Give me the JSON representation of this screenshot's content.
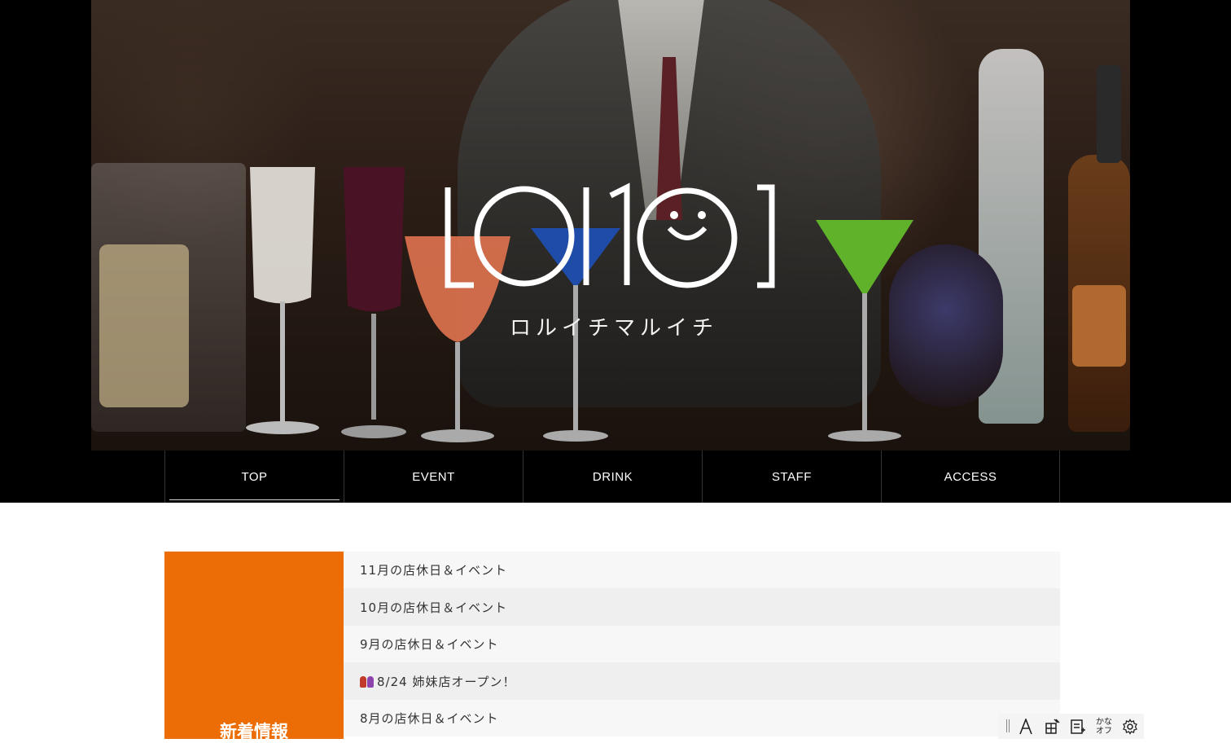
{
  "hero": {
    "logo_text": "LOI101",
    "logo_subtitle": "ロルイチマルイチ"
  },
  "nav": {
    "items": [
      {
        "label": "TOP"
      },
      {
        "label": "EVENT"
      },
      {
        "label": "DRINK"
      },
      {
        "label": "STAFF"
      },
      {
        "label": "ACCESS"
      }
    ]
  },
  "news": {
    "title": "新着情報",
    "items": [
      {
        "label": "11月の店休日＆イベント"
      },
      {
        "label": "10月の店休日＆イベント"
      },
      {
        "label": "9月の店休日＆イベント"
      },
      {
        "label": "8/24 姉妹店オープン！"
      },
      {
        "label": "8月の店休日＆イベント"
      }
    ]
  },
  "toolbar": {
    "kana_label": "かな\nオフ",
    "icons": [
      "grip-icon",
      "font-icon",
      "ruby-icon",
      "reading-icon",
      "kana-toggle",
      "settings-icon"
    ]
  },
  "colors": {
    "accent": "#ec6d05",
    "nav_bg": "#000000",
    "text": "#333333"
  }
}
